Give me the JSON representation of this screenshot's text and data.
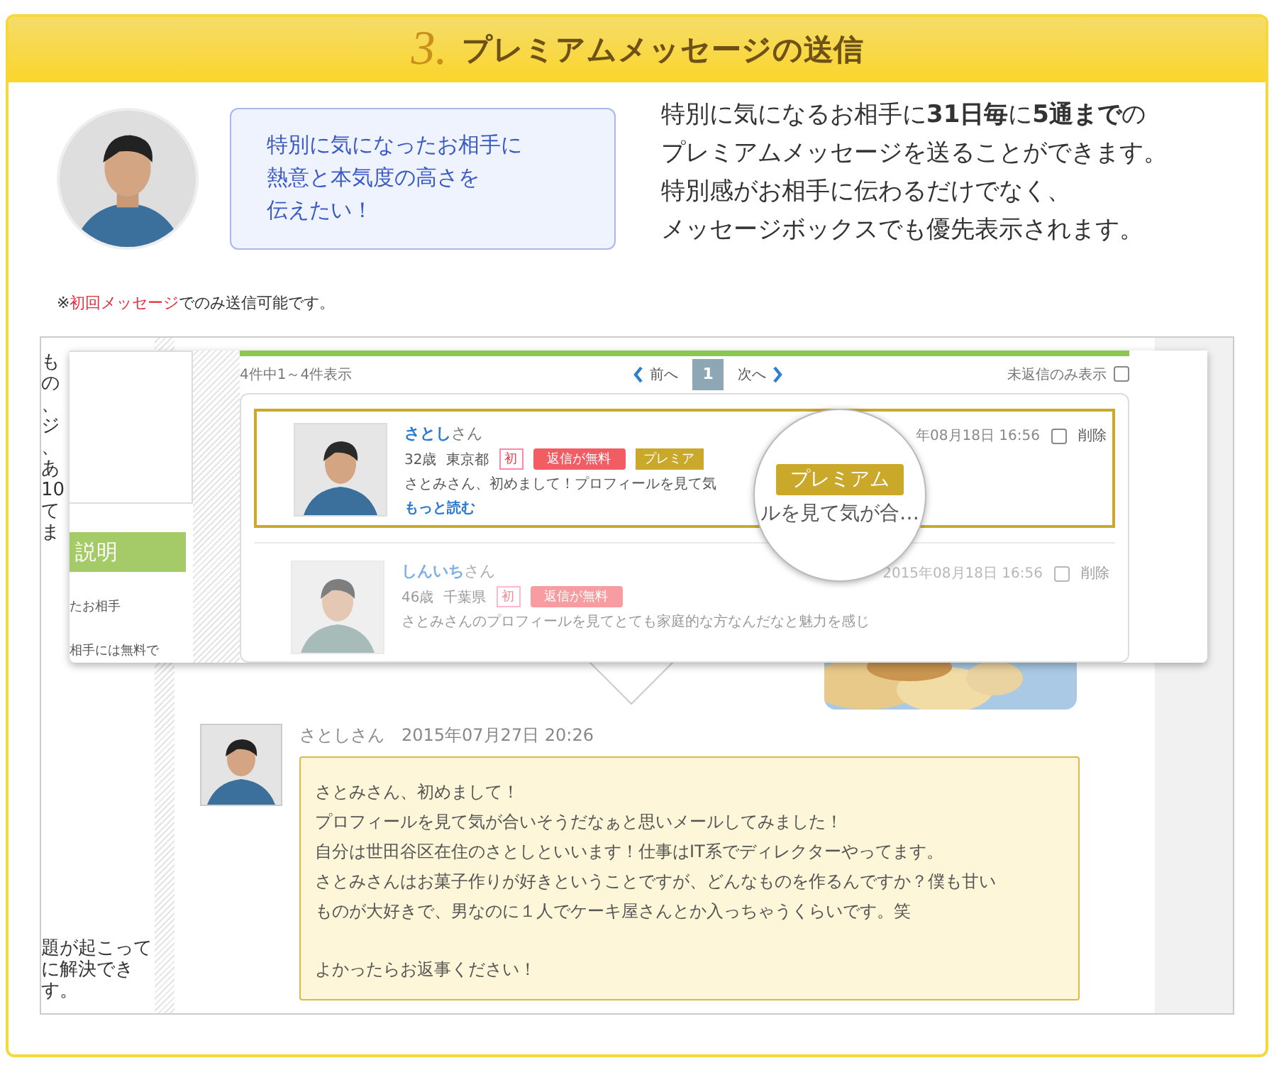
{
  "header": {
    "number": "3.",
    "title": "プレミアムメッセージの送信"
  },
  "bubble": {
    "lines": [
      "特別に気になったお相手に",
      "熱意と本気度の高さを",
      "伝えたい！"
    ]
  },
  "description": [
    "特別に気になるお相手に**31日毎**に**5通まで**の",
    "プレミアムメッセージを送ることができます。",
    "特別感がお相手に伝わるだけでなく、",
    "メッセージボックスでも優先表示されます。"
  ],
  "note": {
    "mark": "※",
    "highlight": "初回メッセージ",
    "rest": "でのみ送信可能です。"
  },
  "background_page": {
    "left_column_lines": [
      "も",
      "の",
      "、",
      "ジ",
      "、",
      "あ",
      "10",
      "て",
      "ま"
    ],
    "lower_lines": [
      "題が起こって",
      "に解決でき",
      "す。"
    ]
  },
  "panel": {
    "sidebar_heading": "説明",
    "sidebar_lines": [
      "たお相手",
      "相手には無料で"
    ],
    "count": "4件中1～4件表示",
    "prev": "前へ",
    "page": "1",
    "next": "次へ",
    "filter": {
      "label": "未返信のみ表示",
      "checked": false
    },
    "messages": [
      {
        "name": "さとし",
        "honorific": "さん",
        "age": "32歳",
        "area": "東京都",
        "first": "初",
        "free": "返信が無料",
        "premium": true,
        "premium_tag": "プレミア",
        "preview": "さとみさん、初めまして！プロフィールを見て気",
        "more": "もっと読む",
        "date": "年08月18日 16:56",
        "checked": false,
        "delete": "削除"
      },
      {
        "name": "しんいち",
        "honorific": "さん",
        "age": "46歳",
        "area": "千葉県",
        "first": "初",
        "free": "返信が無料",
        "premium": false,
        "preview": "さとみさんのプロフィールを見てとても家庭的な方なんだなと魅力を感じ",
        "date": "2015年08月18日 16:56",
        "checked": false,
        "delete": "削除"
      }
    ]
  },
  "magnifier": {
    "tag": "プレミアム",
    "text": "ルを見て気が合…"
  },
  "thread": {
    "sender": "さとしさん",
    "time": "2015年07月27日 20:26",
    "paragraphs": [
      [
        "さとみさん、初めまして！",
        "プロフィールを見て気が合いそうだなぁと思いメールしてみました！",
        "自分は世田谷区在住のさとしといいます！仕事はIT系でディレクターやってます。",
        "さとみさんはお菓子作りが好きということですが、どんなものを作るんですか？僕も甘い",
        "ものが大好きで、男なのに１人でケーキ屋さんとか入っちゃうくらいです。笑"
      ],
      [
        "よかったらお返事ください！"
      ]
    ]
  }
}
